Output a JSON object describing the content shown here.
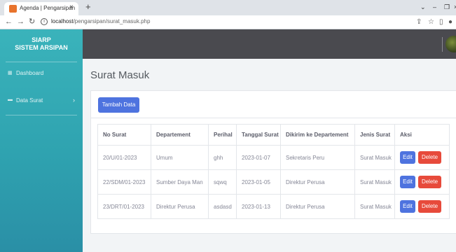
{
  "browser": {
    "tab_title": "Agenda | Pengarsipan",
    "tab_close": "×",
    "new_tab": "+",
    "url_host": "localhost",
    "url_path": "/pengarsipan/surat_masuk.php"
  },
  "sidebar": {
    "brand_line1": "SIARP",
    "brand_line2": "SISTEM ARSIPAN",
    "items": [
      {
        "label": "Dashboard"
      },
      {
        "label": "Data Surat"
      }
    ]
  },
  "page": {
    "title": "Surat Masuk",
    "add_button": "Tambah Data"
  },
  "table": {
    "headers": [
      "No Surat",
      "Departement",
      "Perihal",
      "Tanggal Surat",
      "Dikirim ke Departement",
      "Jenis Surat",
      "Aksi"
    ],
    "rows": [
      {
        "no": "20/U/01-2023",
        "dept": "Umum",
        "perihal": "ghh",
        "tanggal": "2023-01-07",
        "dikirim": "Sekretaris Peru",
        "jenis": "Surat Masuk"
      },
      {
        "no": "22/SDM/01-2023",
        "dept": "Sumber Daya Man",
        "perihal": "sqwq",
        "tanggal": "2023-01-05",
        "dikirim": "Direktur Perusa",
        "jenis": "Surat Masuk"
      },
      {
        "no": "23/DRT/01-2023",
        "dept": "Direktur Perusa",
        "perihal": "asdasd",
        "tanggal": "2023-01-13",
        "dikirim": "Direktur Perusa",
        "jenis": "Surat Masuk"
      }
    ],
    "edit_label": "Edit",
    "delete_label": "Delete"
  },
  "colors": {
    "sidebar_top": "#3ab3bb",
    "sidebar_bottom": "#2a8fa6",
    "topbar": "#4a4a4f",
    "primary": "#4e73df",
    "danger": "#e74a3b"
  },
  "icons": {
    "nav_back": "arrow-left-icon",
    "nav_forward": "arrow-right-icon",
    "reload": "reload-icon",
    "info": "info-icon",
    "share": "share-icon",
    "bookmark": "star-icon",
    "sidebar_toggle": "sidebar-icon",
    "profile": "profile-icon",
    "dashboard": "dashboard-icon",
    "folder": "folder-icon",
    "chevron": "chevron-right-icon"
  }
}
